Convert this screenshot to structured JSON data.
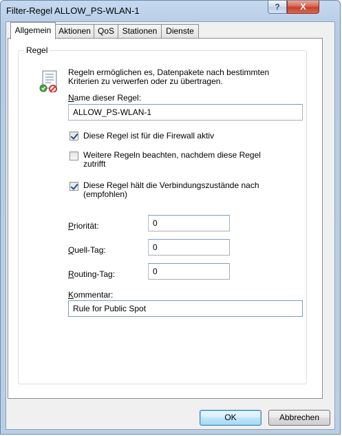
{
  "window": {
    "title": "Filter-Regel ALLOW_PS-WLAN-1",
    "help_glyph": "?",
    "close_glyph": "X"
  },
  "tabs": [
    {
      "label": "Allgemein",
      "active": true
    },
    {
      "label": "Aktionen"
    },
    {
      "label": "QoS"
    },
    {
      "label": "Stationen"
    },
    {
      "label": "Dienste"
    }
  ],
  "group": {
    "label": "Regel",
    "description_line1": "Regeln ermöglichen es, Datenpakete nach bestimmten",
    "description_line2": "Kriterien zu verwerfen oder zu übertragen.",
    "icon": "rule-document-icon"
  },
  "fields": {
    "name": {
      "label_first": "N",
      "label_rest": "ame dieser Regel:",
      "value": "ALLOW_PS-WLAN-1"
    },
    "prioritaet": {
      "label_first": "P",
      "label_rest": "riorität:",
      "value": "0"
    },
    "quell_tag": {
      "label_first": "Q",
      "label_rest": "uell-Tag:",
      "value": "0"
    },
    "routing_tag": {
      "label_first": "R",
      "label_rest": "outing-Tag:",
      "value": "0"
    },
    "kommentar": {
      "label_first": "K",
      "label_rest": "ommentar:",
      "value": "Rule for Public Spot"
    }
  },
  "checkboxes": [
    {
      "line1": "Diese Regel ist für die Firewall aktiv",
      "line2": "",
      "checked": true
    },
    {
      "line1": "Weitere Regeln beachten, nachdem diese Regel",
      "line2": "zutrifft",
      "checked": false
    },
    {
      "line1": "Diese Regel hält die Verbindungszustände nach",
      "line2": "(empfohlen)",
      "checked": true
    }
  ],
  "buttons": {
    "ok": "OK",
    "cancel": "Abbrechen"
  },
  "colors": {
    "accent": "#3c7fb1",
    "check_mark": "#1e4a8a",
    "close_button": "#c7402a"
  }
}
